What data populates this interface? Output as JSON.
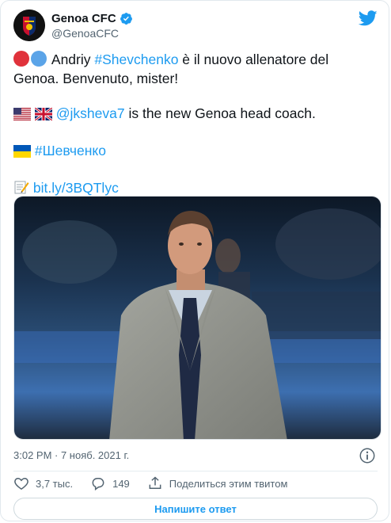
{
  "author": {
    "display_name": "Genoa CFC",
    "handle": "@GenoaCFC"
  },
  "tweet": {
    "line1_prefix": "Andriy ",
    "line1_hashtag": "#Shevchenko",
    "line1_suffix": " è il nuovo allenatore del Genoa. Benvenuto, mister!",
    "line2_mention": "@jksheva7",
    "line2_suffix": " is the new Genoa head coach.",
    "line3_hashtag": "#Шевченко",
    "line4_link": "bit.ly/3BQTlyc"
  },
  "meta": {
    "timestamp": "3:02 PM · 7 нояб. 2021 г."
  },
  "actions": {
    "likes": "3,7 тыс.",
    "replies": "149",
    "share_label": "Поделиться этим твитом"
  },
  "reply_button": "Напишите ответ",
  "colors": {
    "link": "#1d9bf0",
    "genoa_red": "#e0323b",
    "genoa_blue": "#5ba4e8"
  }
}
